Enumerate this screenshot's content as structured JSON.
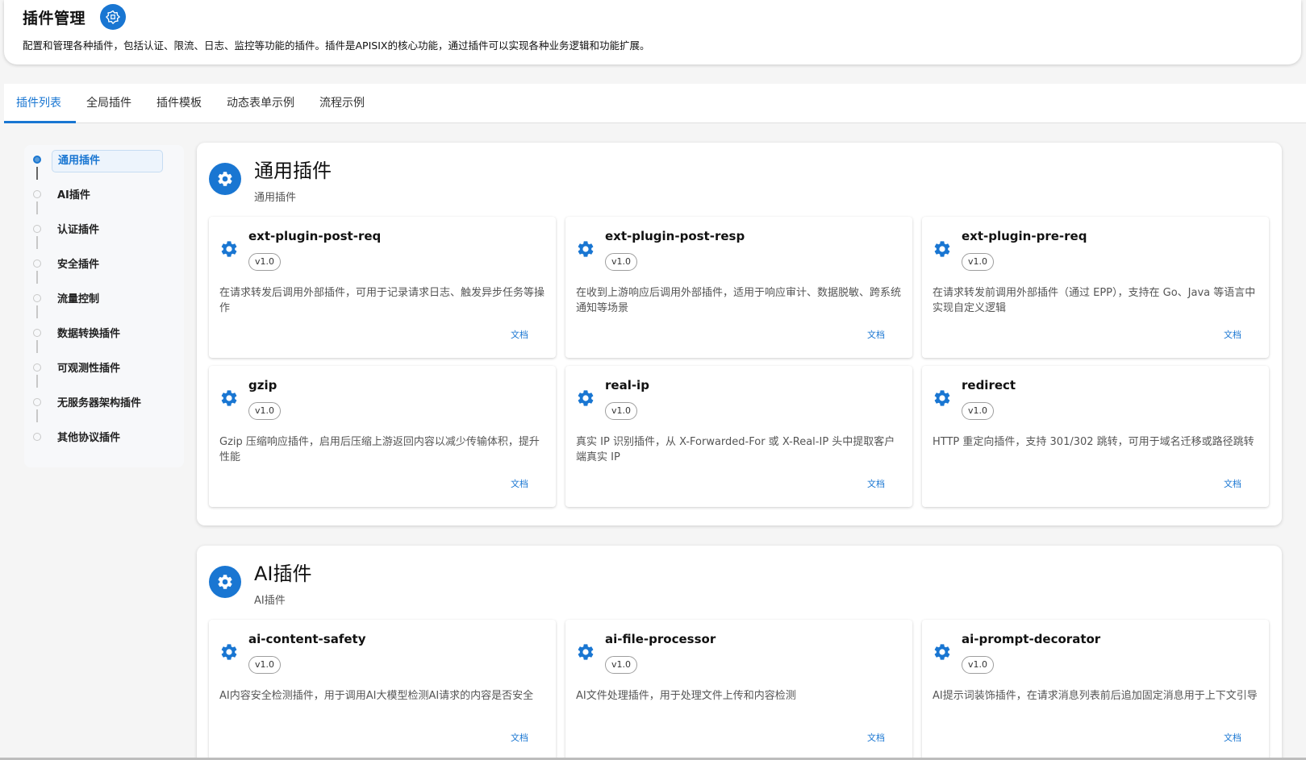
{
  "header": {
    "title": "插件管理",
    "badge_icon": "plugin-badge-icon",
    "description": "配置和管理各种插件，包括认证、限流、日志、监控等功能的插件。插件是APISIX的核心功能，通过插件可以实现各种业务逻辑和功能扩展。"
  },
  "tabs": [
    {
      "label": "插件列表",
      "active": true
    },
    {
      "label": "全局插件",
      "active": false
    },
    {
      "label": "插件模板",
      "active": false
    },
    {
      "label": "动态表单示例",
      "active": false
    },
    {
      "label": "流程示例",
      "active": false
    }
  ],
  "sidebar": {
    "items": [
      {
        "label": "通用插件",
        "active": true
      },
      {
        "label": "AI插件",
        "active": false
      },
      {
        "label": "认证插件",
        "active": false
      },
      {
        "label": "安全插件",
        "active": false
      },
      {
        "label": "流量控制",
        "active": false
      },
      {
        "label": "数据转换插件",
        "active": false
      },
      {
        "label": "可观测性插件",
        "active": false
      },
      {
        "label": "无服务器架构插件",
        "active": false
      },
      {
        "label": "其他协议插件",
        "active": false
      }
    ]
  },
  "sections": [
    {
      "title": "通用插件",
      "subtitle": "通用插件",
      "icon": "gear-icon",
      "cards": [
        {
          "name": "ext-plugin-post-req",
          "version": "v1.0",
          "description": "在请求转发后调用外部插件，可用于记录请求日志、触发异步任务等操作",
          "doc": "文档"
        },
        {
          "name": "ext-plugin-post-resp",
          "version": "v1.0",
          "description": "在收到上游响应后调用外部插件，适用于响应审计、数据脱敏、跨系统通知等场景",
          "doc": "文档"
        },
        {
          "name": "ext-plugin-pre-req",
          "version": "v1.0",
          "description": "在请求转发前调用外部插件（通过 EPP），支持在 Go、Java 等语言中实现自定义逻辑",
          "doc": "文档"
        },
        {
          "name": "gzip",
          "version": "v1.0",
          "description": "Gzip 压缩响应插件，启用后压缩上游返回内容以减少传输体积，提升性能",
          "doc": "文档"
        },
        {
          "name": "real-ip",
          "version": "v1.0",
          "description": "真实 IP 识别插件，从 X-Forwarded-For 或 X-Real-IP 头中提取客户端真实 IP",
          "doc": "文档"
        },
        {
          "name": "redirect",
          "version": "v1.0",
          "description": "HTTP 重定向插件，支持 301/302 跳转，可用于域名迁移或路径跳转",
          "doc": "文档"
        }
      ]
    },
    {
      "title": "AI插件",
      "subtitle": "AI插件",
      "icon": "gear-icon",
      "cards": [
        {
          "name": "ai-content-safety",
          "version": "v1.0",
          "description": "AI内容安全检测插件，用于调用AI大模型检测AI请求的内容是否安全",
          "doc": "文档"
        },
        {
          "name": "ai-file-processor",
          "version": "v1.0",
          "description": "AI文件处理插件，用于处理文件上传和内容检测",
          "doc": "文档"
        },
        {
          "name": "ai-prompt-decorator",
          "version": "v1.0",
          "description": "AI提示词装饰插件，在请求消息列表前后追加固定消息用于上下文引导",
          "doc": "文档"
        }
      ]
    }
  ],
  "colors": {
    "primary": "#1976d2",
    "active_tab": "#1976d2",
    "sidebar_active_bg": "#edf4fc"
  }
}
